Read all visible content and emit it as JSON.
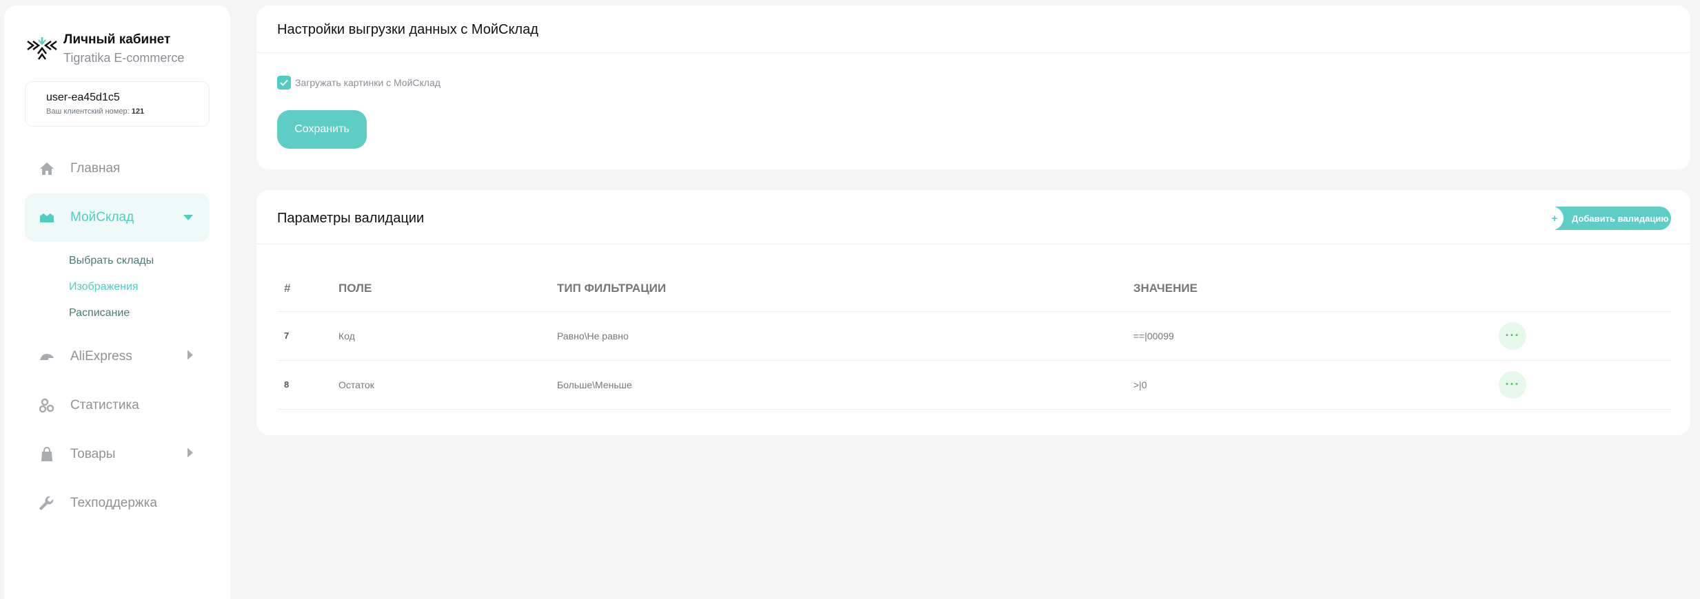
{
  "brand": {
    "title": "Личный кабинет",
    "subtitle": "Tigratika E-commerce"
  },
  "user": {
    "name": "user-ea45d1c5",
    "number_label": "Ваш клиентский номер:",
    "number": "121"
  },
  "nav": {
    "home": "Главная",
    "moysklad": "МойСклад",
    "aliexpress": "AliExpress",
    "stats": "Статистика",
    "goods": "Товары",
    "support": "Техподдержка"
  },
  "subnav": {
    "warehouses": "Выбрать склады",
    "images": "Изображения",
    "schedule": "Расписание"
  },
  "export": {
    "title": "Настройки выгрузки данных с МойСклад",
    "checkbox_label": "Загружать картинки с МойСклад",
    "checkbox_checked": true,
    "save_label": "Сохранить"
  },
  "validation": {
    "title": "Параметры валидации",
    "add_label": "Добавить валидацию",
    "columns": {
      "num": "#",
      "field": "ПОЛЕ",
      "filter": "ТИП ФИЛЬТРАЦИИ",
      "value": "ЗНАЧЕНИЕ"
    },
    "rows": [
      {
        "num": "7",
        "field": "Код",
        "filter": "Равно\\Не равно",
        "value": "==|00099",
        "menu": "···"
      },
      {
        "num": "8",
        "field": "Остаток",
        "filter": "Больше\\Меньше",
        "value": ">|0",
        "menu": "···"
      }
    ]
  },
  "colors": {
    "accent": "#4ecdc4",
    "accent_bg": "#eef9f8",
    "menu_green": "#52c46a"
  }
}
